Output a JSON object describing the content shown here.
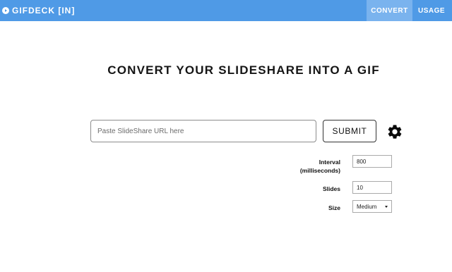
{
  "navbar": {
    "brand": "GIFDECK [IN]",
    "links": [
      {
        "label": "CONVERT",
        "active": true
      },
      {
        "label": "USAGE",
        "active": false
      }
    ],
    "color": "#4f9ae6",
    "active_color": "#7ab3ee"
  },
  "main": {
    "title": "CONVERT YOUR SLIDESHARE INTO A GIF",
    "url_input": {
      "placeholder": "Paste SlideShare URL here",
      "value": ""
    },
    "submit_label": "SUBMIT",
    "settings_icon": "gear-icon"
  },
  "options": {
    "interval": {
      "label_line1": "Interval",
      "label_line2": "(milliseconds)",
      "value": "800"
    },
    "slides": {
      "label": "Slides",
      "value": "10"
    },
    "size": {
      "label": "Size",
      "selected": "Medium"
    }
  }
}
